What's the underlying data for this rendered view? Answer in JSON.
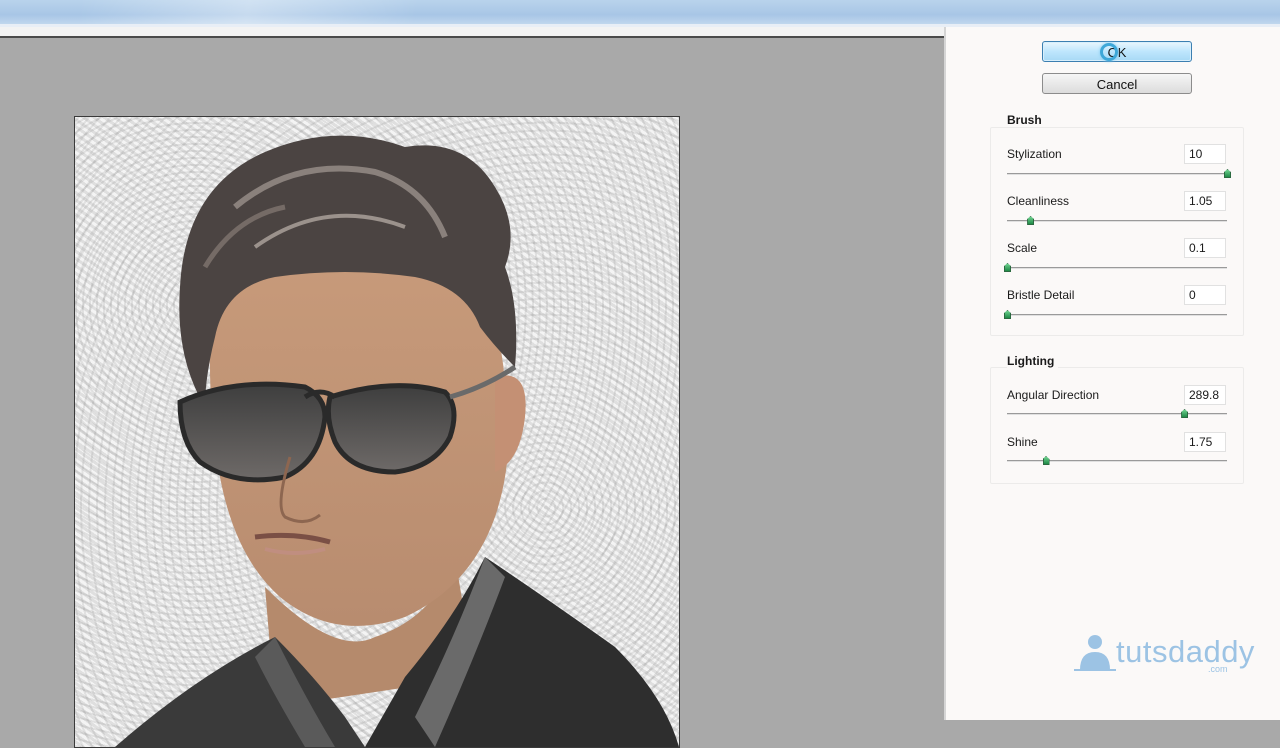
{
  "dialog": {
    "ok_label": "OK",
    "cancel_label": "Cancel"
  },
  "brush": {
    "title": "Brush",
    "controls": [
      {
        "label": "Stylization",
        "value": "10",
        "fraction": 1.0
      },
      {
        "label": "Cleanliness",
        "value": "1.05",
        "fraction": 0.105
      },
      {
        "label": "Scale",
        "value": "0.1",
        "fraction": 0.0
      },
      {
        "label": "Bristle Detail",
        "value": "0",
        "fraction": 0.0
      }
    ]
  },
  "lighting": {
    "title": "Lighting",
    "controls": [
      {
        "label": "Angular Direction",
        "value": "289.8",
        "fraction": 0.805
      },
      {
        "label": "Shine",
        "value": "1.75",
        "fraction": 0.175
      }
    ]
  },
  "watermark": {
    "brand": "tutsdaddy",
    "suffix": ".com"
  },
  "colors": {
    "slider_thumb": "#2fa35a",
    "ok_button_fill": "#bee6fd",
    "logo": "#9cc3e4"
  }
}
